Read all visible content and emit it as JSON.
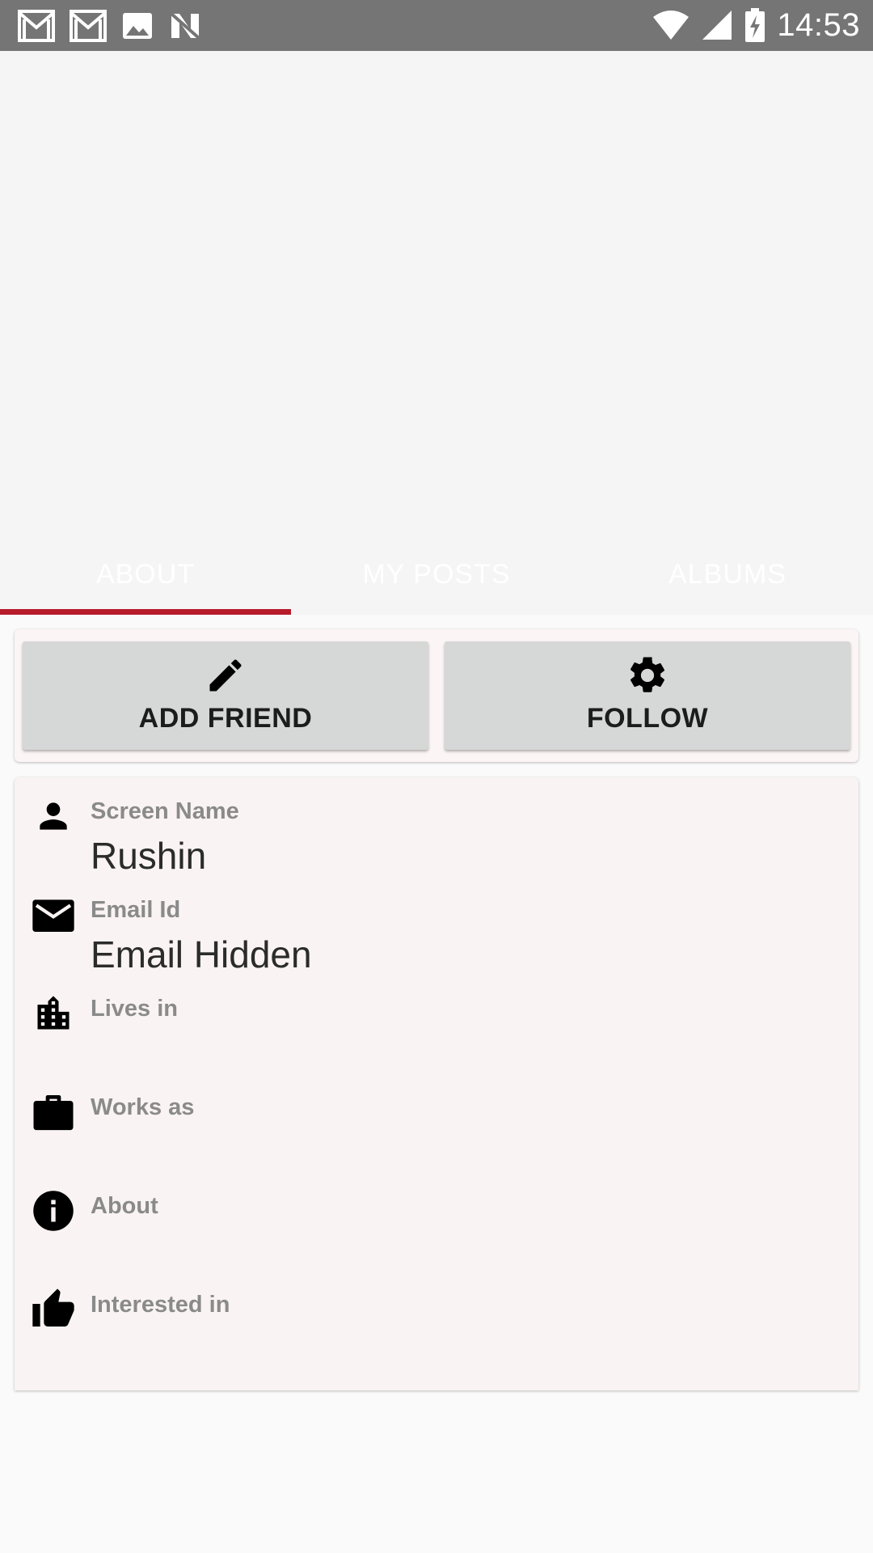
{
  "status_bar": {
    "time": "14:53",
    "left_icons": [
      "gmail-icon",
      "gmail-icon",
      "image-icon",
      "n-app-icon"
    ],
    "right_icons": [
      "wifi-icon",
      "signal-icon",
      "battery-charging-icon"
    ]
  },
  "tabs": [
    {
      "label": "ABOUT",
      "selected": true
    },
    {
      "label": "MY POSTS",
      "selected": false
    },
    {
      "label": "ALBUMS",
      "selected": false
    }
  ],
  "actions": {
    "add_friend": {
      "label": "ADD FRIEND",
      "icon": "pencil-icon"
    },
    "follow": {
      "label": "FOLLOW",
      "icon": "gear-icon"
    }
  },
  "profile_fields": [
    {
      "label": "Screen Name",
      "value": "Rushin",
      "icon": "person-icon"
    },
    {
      "label": "Email Id",
      "value": "Email Hidden",
      "icon": "envelope-icon"
    },
    {
      "label": "Lives in",
      "value": "",
      "icon": "city-icon"
    },
    {
      "label": "Works as",
      "value": "",
      "icon": "briefcase-icon"
    },
    {
      "label": "About",
      "value": "",
      "icon": "info-icon"
    },
    {
      "label": "Interested in",
      "value": "",
      "icon": "thumbs-up-icon"
    }
  ],
  "colors": {
    "status_bar": "#757575",
    "tab_indicator": "#b71c2b",
    "button_bg": "#d6d7d7",
    "card_bg": "#faf3f3"
  }
}
